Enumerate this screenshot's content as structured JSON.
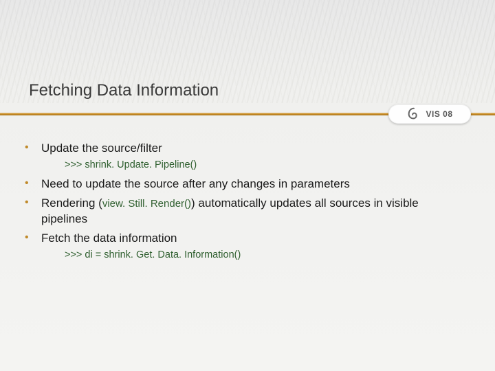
{
  "title": "Fetching Data Information",
  "logo": {
    "text": "VIS 08",
    "icon_name": "swirl-icon"
  },
  "bullets": [
    {
      "text": "Update the source/filter",
      "code_sub": ">>> shrink. Update. Pipeline()"
    },
    {
      "text": "Need to update the source after any changes in parameters"
    },
    {
      "pre": "Rendering (",
      "inline_code": "view. Still. Render()",
      "post": ") automatically updates all sources in visible pipelines"
    },
    {
      "text": "Fetch the data information",
      "code_sub": ">>> di = shrink. Get. Data. Information()"
    }
  ],
  "bullet_char": "•"
}
